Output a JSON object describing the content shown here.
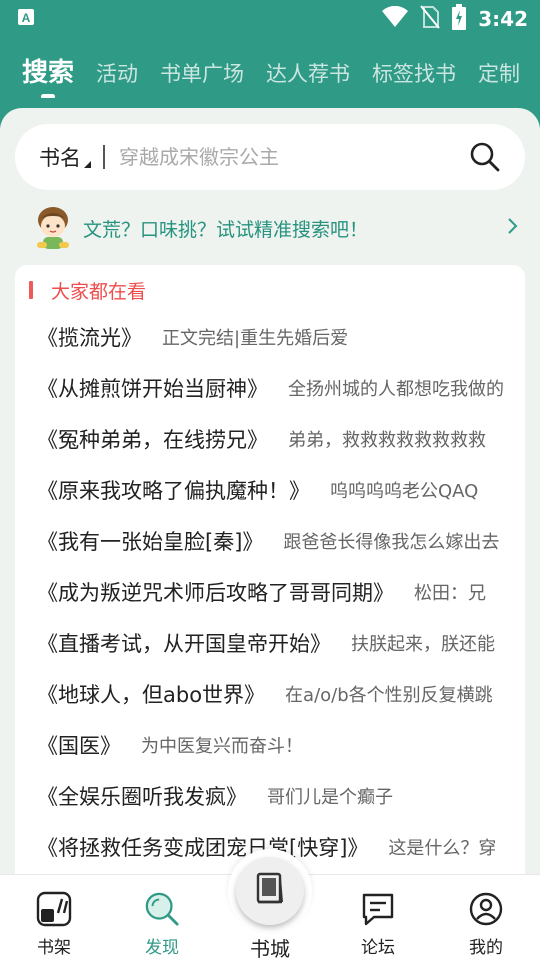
{
  "status_bar": {
    "time": "3:42",
    "icons": [
      "app-notification-icon",
      "wifi-icon",
      "no-sim-icon",
      "battery-charging-icon"
    ]
  },
  "top_tabs": [
    {
      "label": "搜索",
      "active": true
    },
    {
      "label": "活动",
      "active": false
    },
    {
      "label": "书单广场",
      "active": false
    },
    {
      "label": "达人荐书",
      "active": false
    },
    {
      "label": "标签找书",
      "active": false
    },
    {
      "label": "定制",
      "active": false
    }
  ],
  "search": {
    "type_label": "书名",
    "placeholder": "穿越成宋徽宗公主",
    "value": ""
  },
  "hint": {
    "text": "文荒？口味挑？试试精准搜索吧！"
  },
  "popular": {
    "title": "大家都在看",
    "books": [
      {
        "title": "《揽流光》",
        "desc": "正文完结|重生先婚后爱"
      },
      {
        "title": "《从摊煎饼开始当厨神》",
        "desc": "全扬州城的人都想吃我做的"
      },
      {
        "title": "《冤种弟弟，在线捞兄》",
        "desc": "弟弟，救救救救救救救救"
      },
      {
        "title": "《原来我攻略了偏执魔种！》",
        "desc": "呜呜呜呜老公QAQ"
      },
      {
        "title": "《我有一张始皇脸[秦]》",
        "desc": "跟爸爸长得像我怎么嫁出去"
      },
      {
        "title": "《成为叛逆咒术师后攻略了哥哥同期》",
        "desc": "松田：兄"
      },
      {
        "title": "《直播考试，从开国皇帝开始》",
        "desc": "扶朕起来，朕还能"
      },
      {
        "title": "《地球人，但abo世界》",
        "desc": "在a/o/b各个性别反复横跳"
      },
      {
        "title": "《国医》",
        "desc": "为中医复兴而奋斗！"
      },
      {
        "title": "《全娱乐圈听我发疯》",
        "desc": "哥们儿是个癫子"
      },
      {
        "title": "《将拯救任务变成团宠日常[快穿]》",
        "desc": "这是什么？穿"
      }
    ]
  },
  "bottom_nav": {
    "items": [
      {
        "label": "书架",
        "icon": "bookshelf-icon",
        "active": false
      },
      {
        "label": "发现",
        "icon": "discover-search-icon",
        "active": true
      },
      {
        "label": "书城",
        "icon": "bookstore-icon",
        "active": false
      },
      {
        "label": "论坛",
        "icon": "forum-chat-icon",
        "active": false
      },
      {
        "label": "我的",
        "icon": "profile-icon",
        "active": false
      }
    ]
  },
  "colors": {
    "brand": "#2f9a86",
    "accent_red": "#ee4d4d",
    "background": "#eef3f0"
  }
}
